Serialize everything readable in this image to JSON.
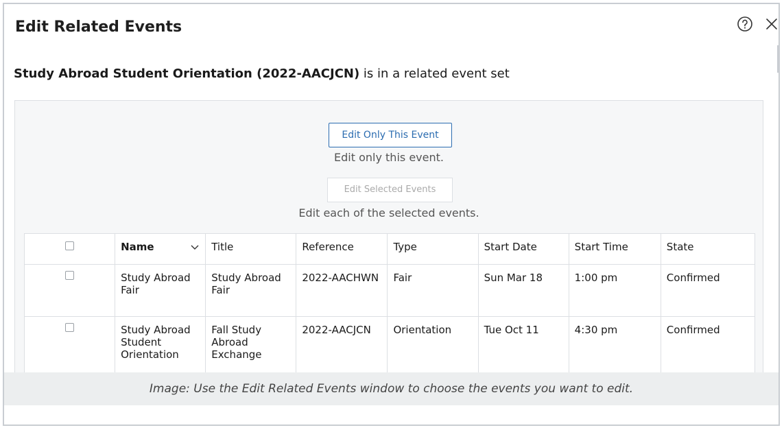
{
  "dialog": {
    "title": "Edit Related Events",
    "subtitle_bold": "Study Abroad Student Orientation (2022-AACJCN)",
    "subtitle_rest": " is in a related event set"
  },
  "actions": {
    "edit_only_label": "Edit Only This Event",
    "edit_only_hint": "Edit only this event.",
    "edit_selected_label": "Edit Selected Events",
    "edit_selected_hint": "Edit each of the selected events."
  },
  "table": {
    "headers": [
      "Name",
      "Title",
      "Reference",
      "Type",
      "Start Date",
      "Start Time",
      "State"
    ],
    "rows": [
      {
        "name": "Study Abroad Fair",
        "title": "Study Abroad Fair",
        "reference": "2022-AACHWN",
        "type": "Fair",
        "start_date": "Sun Mar 18",
        "start_time": "1:00 pm",
        "state": "Confirmed"
      },
      {
        "name": "Study Abroad Student Orientation",
        "title": "Fall Study Abroad Exchange",
        "reference": "2022-AACJCN",
        "type": "Orientation",
        "start_date": "Tue Oct 11",
        "start_time": "4:30 pm",
        "state": "Confirmed"
      }
    ]
  },
  "caption": "Image: Use the Edit Related Events window to choose the events you want to edit.",
  "icons": {
    "help": "help-circle-icon",
    "close": "close-icon",
    "sort": "chevron-down-icon"
  }
}
